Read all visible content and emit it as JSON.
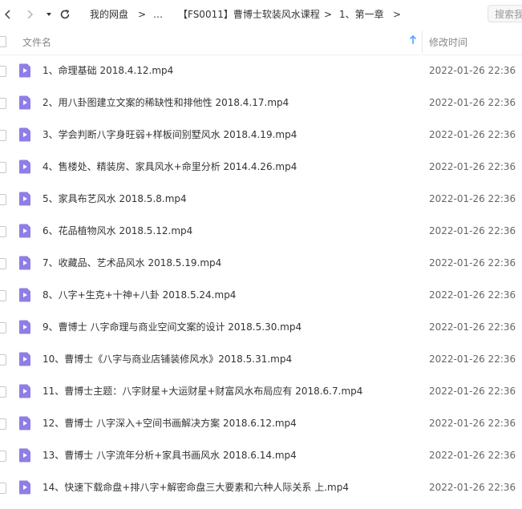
{
  "breadcrumbs": [
    "我的网盘",
    "…",
    "【FS0011】曹博士软装风水课程",
    "1、第一章"
  ],
  "breadcrumb_separator": ">",
  "search": {
    "placeholder": "搜索我"
  },
  "header": {
    "name_label": "文件名",
    "time_label": "修改时间",
    "sort_arrow": "↑"
  },
  "colors": {
    "file_icon": "#8e7ee6",
    "sort_arrow": "#4a9eff",
    "header_text": "#888888"
  },
  "files": [
    {
      "name": "1、命理基础 2018.4.12.mp4",
      "time": "2022-01-26 22:36"
    },
    {
      "name": "2、用八卦图建立文案的稀缺性和排他性 2018.4.17.mp4",
      "time": "2022-01-26 22:36"
    },
    {
      "name": "3、学会判断八字身旺弱+样板间别墅风水 2018.4.19.mp4",
      "time": "2022-01-26 22:36"
    },
    {
      "name": "4、售楼处、精装房、家具风水+命里分析 2014.4.26.mp4",
      "time": "2022-01-26 22:36"
    },
    {
      "name": "5、家具布艺风水 2018.5.8.mp4",
      "time": "2022-01-26 22:36"
    },
    {
      "name": "6、花品植物风水 2018.5.12.mp4",
      "time": "2022-01-26 22:36"
    },
    {
      "name": "7、收藏品、艺术品风水 2018.5.19.mp4",
      "time": "2022-01-26 22:36"
    },
    {
      "name": "8、八字+生克+十神+八卦 2018.5.24.mp4",
      "time": "2022-01-26 22:36"
    },
    {
      "name": "9、曹博士 八字命理与商业空间文案的设计 2018.5.30.mp4",
      "time": "2022-01-26 22:36"
    },
    {
      "name": "10、曹博士《八字与商业店铺装修风水》2018.5.31.mp4",
      "time": "2022-01-26 22:36"
    },
    {
      "name": "11、曹博士主题：八字财星+大运财星+财富风水布局应有 2018.6.7.mp4",
      "time": "2022-01-26 22:36"
    },
    {
      "name": "12、曹博士 八字深入+空间书画解决方案 2018.6.12.mp4",
      "time": "2022-01-26 22:36"
    },
    {
      "name": "13、曹博士 八字流年分析+家具书画风水 2018.6.14.mp4",
      "time": "2022-01-26 22:36"
    },
    {
      "name": "14、快速下载命盘+排八字+解密命盘三大要素和六种人际关系 上.mp4",
      "time": "2022-01-26 22:36"
    }
  ]
}
